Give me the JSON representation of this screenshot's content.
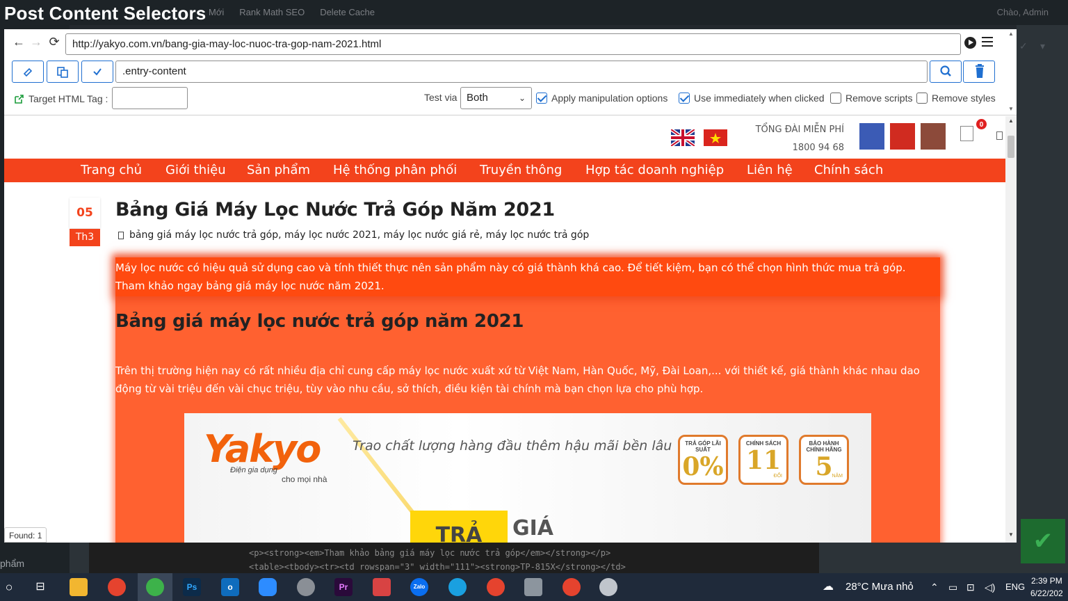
{
  "app_title": "Post Content Selectors",
  "wp_admin": {
    "items": [
      "Mới",
      "Rank Math SEO",
      "Delete Cache"
    ],
    "greeting": "Chào, Admin",
    "sidebar_label": "phẩm"
  },
  "browser": {
    "url": "http://yakyo.com.vn/bang-gia-may-loc-nuoc-tra-gop-nam-2021.html"
  },
  "toolbar": {
    "selector_value": ".entry-content"
  },
  "options": {
    "target_tag_label": "Target HTML Tag :",
    "target_tag_value": "",
    "test_via_label": "Test via",
    "test_via_value": "Both",
    "apply_manipulation_label": "Apply manipulation options",
    "apply_manipulation_checked": true,
    "use_immediately_label": "Use immediately when clicked",
    "use_immediately_checked": true,
    "remove_scripts_label": "Remove scripts",
    "remove_scripts_checked": false,
    "remove_styles_label": "Remove styles",
    "remove_styles_checked": false
  },
  "site": {
    "hotline_label": "TỔNG ĐÀI MIỄN PHÍ",
    "hotline_number": "1800 94 68",
    "cart_count": "0",
    "menu": [
      "Trang chủ",
      "Giới thiệu",
      "Sản phẩm",
      "Hệ thống phân phối",
      "Truyền thông",
      "Hợp tác doanh nghiệp",
      "Liên hệ",
      "Chính sách"
    ],
    "accent_color": "#f3431c"
  },
  "post": {
    "day": "05",
    "month": "Th3",
    "title": "Bảng Giá Máy Lọc Nước Trả Góp Năm 2021",
    "tags": "bảng giá máy lọc nước trả góp, máy lọc nước 2021, máy lọc nước giá rẻ, máy lọc nước trả góp",
    "intro_line1": "Máy lọc nước có hiệu quả sử dụng cao và tính thiết thực nên sản phẩm này có giá thành khá cao. Để tiết kiệm, bạn có thể chọn hình thức mua trả góp.",
    "intro_line2": "Tham khảo ngay bảng giá máy lọc nước năm 2021.",
    "h2": "Bảng giá máy lọc nước trả góp năm 2021",
    "para_line1": "Trên thị trường hiện nay có rất nhiều địa chỉ cung cấp máy lọc nước xuất xứ từ Việt Nam, Hàn Quốc, Mỹ, Đài Loan,... với thiết kế, giá thành khác nhau dao",
    "para_line2": "động từ vài triệu đến vài chục triệu, tùy vào nhu cầu, sở thích, điều kiện tài chính mà bạn chọn lựa cho phù hợp."
  },
  "banner": {
    "logo": "Yakyo",
    "logo_sub1": "Điện gia dụng",
    "logo_sub2": "cho mọi nhà",
    "tagline": "Trao chất lượng hàng đầu thêm hậu mãi bền lâu",
    "badges": [
      {
        "top": "TRẢ GÓP LÃI SUẤT",
        "num": "0%",
        "unit": ""
      },
      {
        "top": "CHÍNH SÁCH",
        "num": "11",
        "unit": "ĐỔI"
      },
      {
        "top": "BẢO HÀNH CHÍNH HÃNG",
        "num": "5",
        "unit": "NĂM"
      }
    ],
    "btn1": "TRẢ",
    "btn2": "GIÁ"
  },
  "found_label": "Found: 1",
  "code_lines": [
    "<p><strong><em>Tham khảo bảng giá máy lọc nước trả góp</em></strong></p>",
    "<table><tbody><tr><td rowspan=\"3\" width=\"111\"><strong>TP-815X</strong></td>"
  ],
  "taskbar": {
    "weather": "28°C  Mưa nhỏ",
    "lang": "ENG",
    "time": "2:39 PM",
    "date": "6/22/202"
  }
}
